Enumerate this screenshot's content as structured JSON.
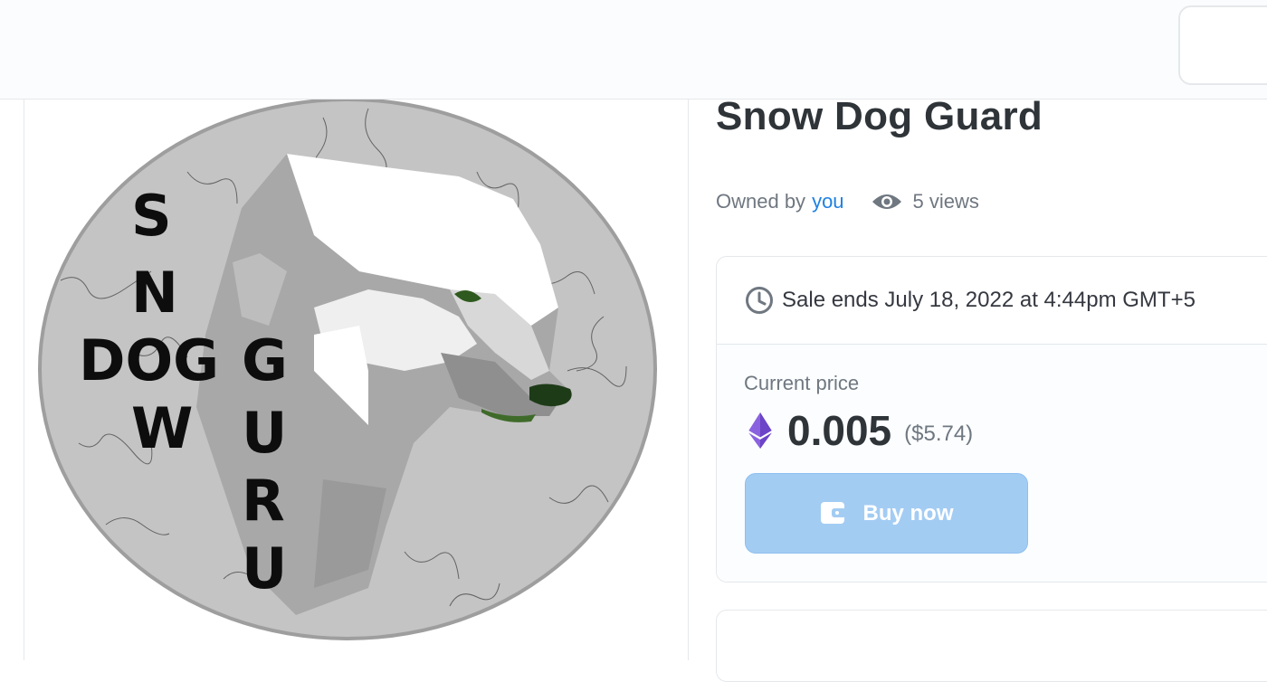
{
  "item": {
    "title": "Snow Dog Guard",
    "owned_by_label": "Owned by",
    "owner": "you",
    "views": "5 views",
    "image_icon": "snow-dog-guru-artwork"
  },
  "image_text": {
    "word1": [
      "S",
      "N",
      "O",
      "W"
    ],
    "word2": "DOG",
    "word3": [
      "G",
      "U",
      "R",
      "U"
    ]
  },
  "sale": {
    "ends_text": "Sale ends July 18, 2022 at 4:44pm GMT+5",
    "price_label": "Current price",
    "price": "0.005",
    "price_usd": "($5.74)",
    "buy_label": "Buy now"
  },
  "icons": {
    "views": "eye-icon",
    "sale": "clock-icon",
    "currency": "ethereum-icon",
    "buy": "wallet-icon"
  },
  "colors": {
    "link": "#2081e2",
    "button": "#a3ccf3",
    "title": "#2f3439",
    "muted": "#6f7780"
  }
}
